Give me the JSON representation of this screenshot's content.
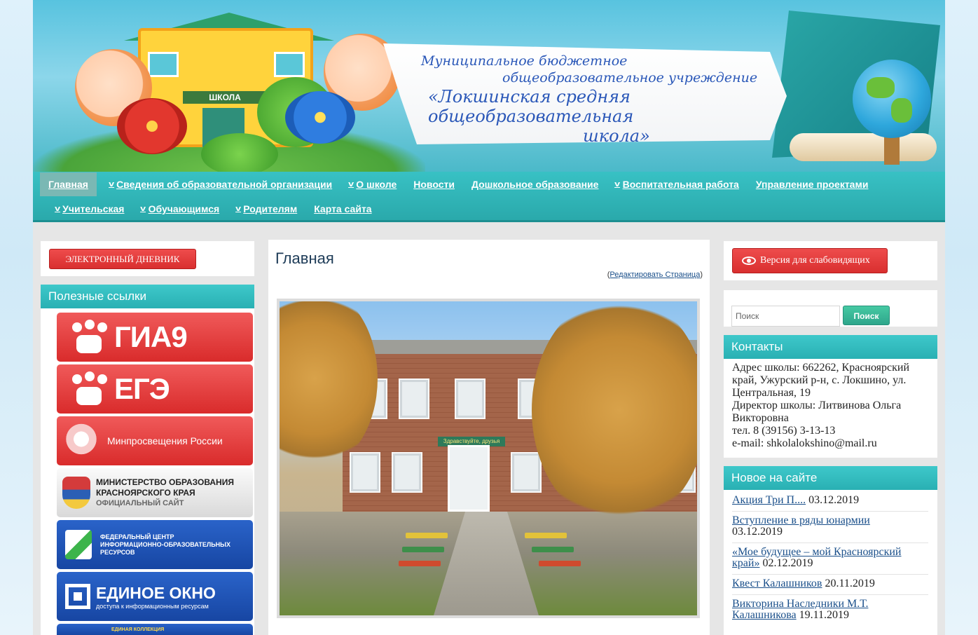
{
  "header": {
    "school_sign": "ШКОЛА",
    "banner_line1": "Муниципальное бюджетное",
    "banner_line2": "общеобразовательное учреждение",
    "banner_line3": "«Локшинская средняя общеобразовательная",
    "banner_line4": "школа»"
  },
  "nav": {
    "row1": [
      {
        "label": "Главная",
        "active": true,
        "dropdown": false
      },
      {
        "label": "Сведения об образовательной организации",
        "dropdown": true
      },
      {
        "label": "О школе",
        "dropdown": true
      },
      {
        "label": "Новости",
        "dropdown": false
      },
      {
        "label": "Дошкольное образование",
        "dropdown": false
      },
      {
        "label": "Воспитательная работа",
        "dropdown": true
      },
      {
        "label": "Управление проектами",
        "dropdown": false
      }
    ],
    "row2": [
      {
        "label": "Учительская",
        "dropdown": true
      },
      {
        "label": "Обучающимся",
        "dropdown": true
      },
      {
        "label": "Родителям",
        "dropdown": true
      },
      {
        "label": "Карта сайта",
        "dropdown": false
      }
    ]
  },
  "left": {
    "diary_button": "ЭЛЕКТРОННЫЙ ДНЕВНИК",
    "useful_links_title": "Полезные ссылки",
    "links": {
      "gia9": "ГИА9",
      "ege": "ЕГЭ",
      "minpros": "Минпросвещения России",
      "minobr_line1": "МИНИСТЕРСТВО ОБРАЗОВАНИЯ",
      "minobr_line2": "КРАСНОЯРСКОГО КРАЯ",
      "minobr_line3": "ОФИЦИАЛЬНЫЙ САЙТ",
      "fcior_line1": "ФЕДЕРАЛЬНЫЙ ЦЕНТР",
      "fcior_line2": "ИНФОРМАЦИОННО-ОБРАЗОВАТЕЛЬНЫХ",
      "fcior_line3": "РЕСУРСОВ",
      "okno_big": "ЕДИНОЕ ОКНО",
      "okno_sub": "доступа к информационным ресурсам",
      "collection_label": "ЕДИНАЯ КОЛЛЕКЦИЯ"
    }
  },
  "main": {
    "title": "Главная",
    "edit_open": "(",
    "edit_link": "Редактировать Страница",
    "edit_close": ")"
  },
  "photo": {
    "entrance_sign": "Здравствуйте, друзья"
  },
  "right": {
    "vision_button": "Версия для слабовидящих",
    "search_placeholder": "Поиск",
    "search_button": "Поиск",
    "contacts_title": "Контакты",
    "contacts": [
      "Адрес школы: 662262, Красноярский край, Ужурский р-н, с. Локшино, ул. Центральная, 19",
      "Директор школы: Литвинова Ольга Викторовна",
      "тел. 8 (39156) 3-13-13",
      "e-mail: shkolalokshino@mail.ru"
    ],
    "news_title": "Новое на сайте",
    "news": [
      {
        "link": "Акция Три П....",
        "date": "03.12.2019"
      },
      {
        "link": "Вступление в ряды юнармии",
        "date": "03.12.2019"
      },
      {
        "link": "«Мое будущее – мой Красноярский край»",
        "date": "02.12.2019"
      },
      {
        "link": "Квест Калашников",
        "date": "20.11.2019"
      },
      {
        "link": "Викторина Наследники М.Т. Калашникова",
        "date": "19.11.2019"
      }
    ]
  }
}
